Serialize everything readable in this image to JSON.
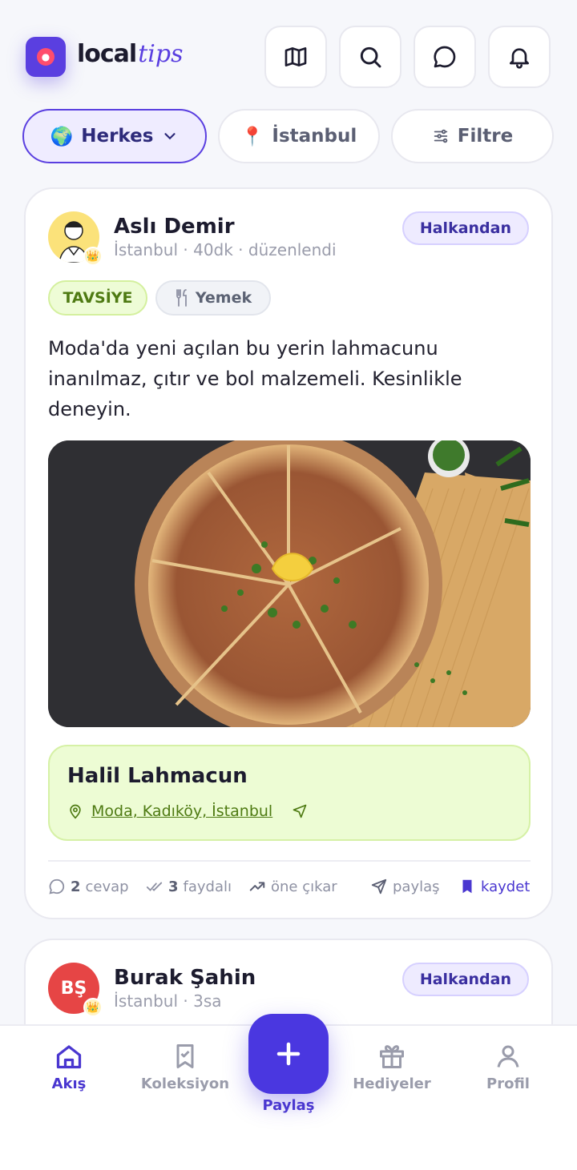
{
  "app": {
    "logo_local": "local",
    "logo_tips": "tips"
  },
  "header": {
    "icons": [
      "map-icon",
      "search-icon",
      "chat-icon",
      "bell-icon"
    ]
  },
  "filters": {
    "audience": {
      "emoji": "🌍",
      "label": "Herkes"
    },
    "city": {
      "emoji": "📍",
      "label": "İstanbul"
    },
    "filter": {
      "label": "Filtre"
    }
  },
  "post": {
    "author": "Aslı Demir",
    "meta": "İstanbul · 40dk · düzenlendi",
    "badge": "Halkandan",
    "tag_type": "TAVSİYE",
    "tag_category": "Yemek",
    "text": "Moda'da yeni açılan bu yerin lahmacunu inanılmaz, çıtır ve bol malzemeli. Kesinlikle deneyin.",
    "place_name": "Halil Lahmacun",
    "place_address": "Moda, Kadıköy, İstanbul",
    "actions": {
      "replies_count": "2",
      "replies_label": "cevap",
      "useful_count": "3",
      "useful_label": "faydalı",
      "promote_label": "öne çıkar",
      "share_label": "paylaş",
      "save_label": "kaydet"
    }
  },
  "post2": {
    "author": "Burak Şahin",
    "initials": "BŞ",
    "meta": "İstanbul · 3sa",
    "badge": "Halkandan"
  },
  "tabbar": {
    "feed": "Akış",
    "collection": "Koleksiyon",
    "share": "Paylaş",
    "gifts": "Hediyeler",
    "profile": "Profil"
  },
  "colors": {
    "accent": "#4a37e0",
    "green": "#4e7a12",
    "badge_bg": "#eeebff"
  }
}
